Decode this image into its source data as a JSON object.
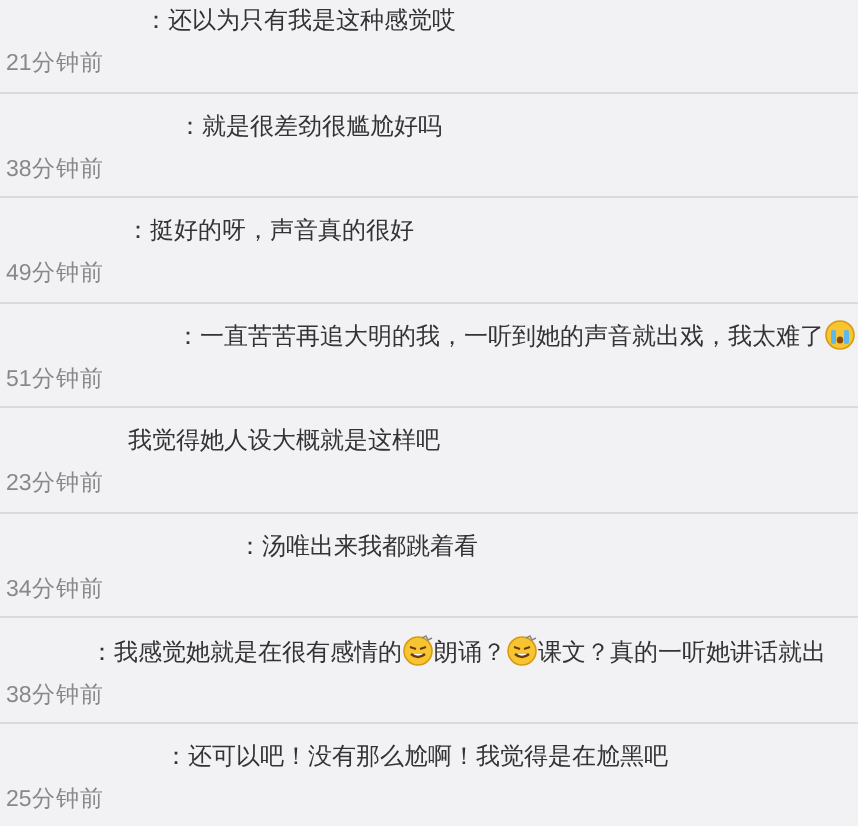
{
  "comments": [
    {
      "content": [
        {
          "kind": "text",
          "text": "：还以为只有我是这种感觉哎"
        }
      ],
      "time": "21分钟前"
    },
    {
      "content": [
        {
          "kind": "text",
          "text": "：就是很差劲很尴尬好吗"
        }
      ],
      "time": "38分钟前"
    },
    {
      "content": [
        {
          "kind": "text",
          "text": "：挺好的呀，声音真的很好"
        }
      ],
      "time": "49分钟前"
    },
    {
      "content": [
        {
          "kind": "text",
          "text": "：一直苦苦再追大明的我，一听到她的声音就出戏，我太难了"
        },
        {
          "kind": "crying-emoji"
        }
      ],
      "time": "51分钟前"
    },
    {
      "content": [
        {
          "kind": "text",
          "text": "我觉得她人设大概就是这样吧"
        }
      ],
      "time": "23分钟前"
    },
    {
      "content": [
        {
          "kind": "text",
          "text": "：汤唯出来我都跳着看"
        }
      ],
      "time": "34分钟前"
    },
    {
      "content": [
        {
          "kind": "text",
          "text": "：我感觉她就是在很有感情的"
        },
        {
          "kind": "dizzy-emoji"
        },
        {
          "kind": "text",
          "text": "朗诵？"
        },
        {
          "kind": "dizzy-emoji"
        },
        {
          "kind": "text",
          "text": "课文？真的一听她讲话就出"
        }
      ],
      "time": "38分钟前"
    },
    {
      "content": [
        {
          "kind": "text",
          "text": "：还可以吧！没有那么尬啊！我觉得是在尬黑吧"
        }
      ],
      "time": "25分钟前"
    }
  ]
}
